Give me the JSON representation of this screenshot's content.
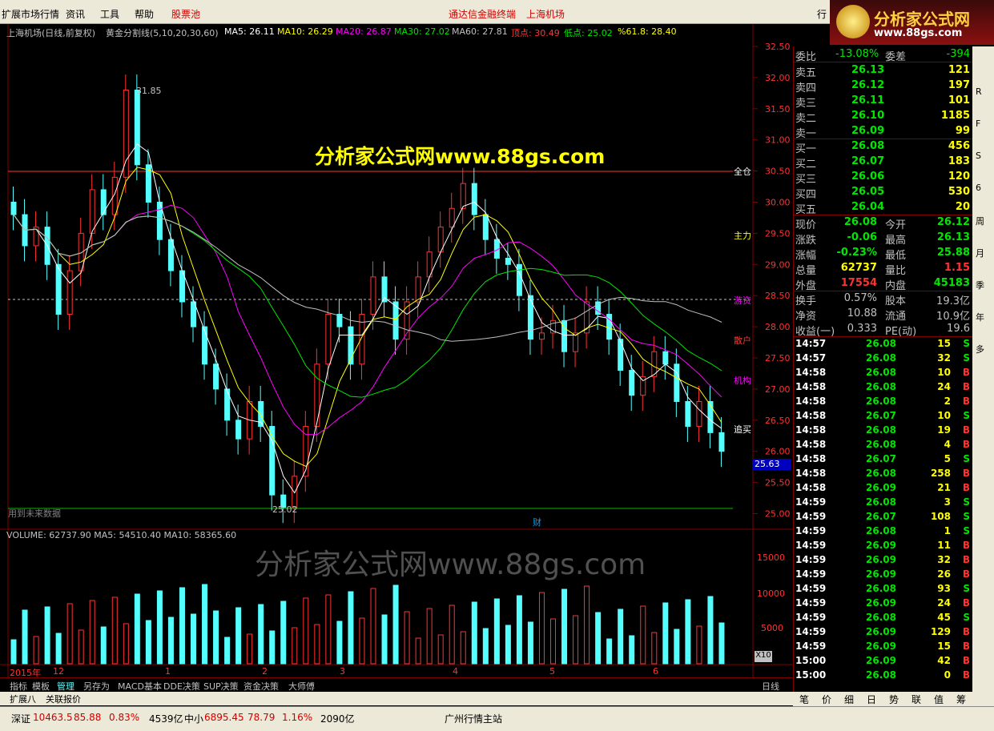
{
  "menu": {
    "items": [
      "扩展市场行情",
      "资讯",
      "工具",
      "帮助",
      "股票池"
    ],
    "center": [
      "通达信金融终端",
      "上海机场"
    ],
    "right": "行"
  },
  "logo": {
    "main": "分析家公式网",
    "url": "www.88gs.com"
  },
  "chart": {
    "title": "上海机场(日线,前复权)",
    "indicator": "黄金分割线(5,10,20,30,60)",
    "ma5": "MA5: 26.11",
    "ma10": "MA10: 26.29",
    "ma20": "MA20: 26.87",
    "ma30": "MA30: 27.02",
    "ma60": "MA60: 27.81",
    "top": "顶点: 30.49",
    "bottom": "低点: 25.02",
    "fib": "%61.8: 28.40",
    "high_label": "31.85",
    "low_label": "25.02",
    "future_note": "用到未来数据",
    "cai": "财",
    "watermark": "分析家公式网www.88gs.com",
    "watermark2": "分析家公式网www.88gs.com",
    "levels": [
      "全仓",
      "主力",
      "游资",
      "散户",
      "机构",
      "追买"
    ],
    "price_axis": [
      "32.50",
      "32.00",
      "31.50",
      "31.00",
      "30.50",
      "30.00",
      "29.50",
      "29.00",
      "28.50",
      "28.00",
      "27.50",
      "27.00",
      "26.50",
      "26.00",
      "25.50",
      "25.00"
    ],
    "current_price": "25.63",
    "volume_line": "VOLUME: 62737.90  MA5: 54510.40  MA10: 58365.60",
    "vol_axis": [
      "15000",
      "10000",
      "5000"
    ],
    "vol_unit": "X10",
    "date_labels": [
      "2015年",
      "12",
      "1",
      "2",
      "3",
      "4",
      "5",
      "6"
    ]
  },
  "bottom_tabs": [
    "指标",
    "模板",
    "管理",
    "另存为",
    "MACD基本",
    "DDE决策",
    "SUP决策",
    "资金决策",
    "大师傅"
  ],
  "period": "日线",
  "period_btns": [
    "+",
    "-",
    "0"
  ],
  "sub_tabs": [
    "扩展八",
    "关联报价"
  ],
  "status": {
    "sz_label": "深证",
    "sz_val": "10463.5",
    "sz_chg": "85.88",
    "sz_pct": "0.83%",
    "sz_amt": "4539亿",
    "zx_label": "中小",
    "zx_val": "6895.45",
    "zx_chg": "78.79",
    "zx_pct": "1.16%",
    "zx_amt": "2090亿",
    "station": "广州行情主站"
  },
  "quote": {
    "weibi_label": "委比",
    "weibi": "-13.08%",
    "weicha_label": "委差",
    "weicha": "-394",
    "sells": [
      {
        "label": "卖五",
        "price": "26.13",
        "vol": "121"
      },
      {
        "label": "卖四",
        "price": "26.12",
        "vol": "197"
      },
      {
        "label": "卖三",
        "price": "26.11",
        "vol": "101"
      },
      {
        "label": "卖二",
        "price": "26.10",
        "vol": "1185"
      },
      {
        "label": "卖一",
        "price": "26.09",
        "vol": "99"
      }
    ],
    "buys": [
      {
        "label": "买一",
        "price": "26.08",
        "vol": "456"
      },
      {
        "label": "买二",
        "price": "26.07",
        "vol": "183"
      },
      {
        "label": "买三",
        "price": "26.06",
        "vol": "120"
      },
      {
        "label": "买四",
        "price": "26.05",
        "vol": "530"
      },
      {
        "label": "买五",
        "price": "26.04",
        "vol": "20"
      }
    ],
    "stats": [
      {
        "l1": "现价",
        "v1": "26.08",
        "l2": "今开",
        "v2": "26.12"
      },
      {
        "l1": "涨跌",
        "v1": "-0.06",
        "l2": "最高",
        "v2": "26.13"
      },
      {
        "l1": "涨幅",
        "v1": "-0.23%",
        "l2": "最低",
        "v2": "25.88"
      },
      {
        "l1": "总量",
        "v1": "62737",
        "l2": "量比",
        "v2": "1.15"
      },
      {
        "l1": "外盘",
        "v1": "17554",
        "l2": "内盘",
        "v2": "45183"
      }
    ],
    "fund": [
      {
        "l1": "换手",
        "v1": "0.57%",
        "l2": "股本",
        "v2": "19.3亿"
      },
      {
        "l1": "净资",
        "v1": "10.88",
        "l2": "流通",
        "v2": "10.9亿"
      },
      {
        "l1": "收益(一)",
        "v1": "0.333",
        "l2": "PE(动)",
        "v2": "19.6"
      }
    ]
  },
  "ticks": [
    {
      "t": "14:57",
      "p": "26.08",
      "v": "15",
      "s": "S"
    },
    {
      "t": "14:57",
      "p": "26.08",
      "v": "32",
      "s": "S"
    },
    {
      "t": "14:58",
      "p": "26.08",
      "v": "10",
      "s": "B"
    },
    {
      "t": "14:58",
      "p": "26.08",
      "v": "24",
      "s": "B"
    },
    {
      "t": "14:58",
      "p": "26.08",
      "v": "2",
      "s": "B"
    },
    {
      "t": "14:58",
      "p": "26.07",
      "v": "10",
      "s": "S"
    },
    {
      "t": "14:58",
      "p": "26.08",
      "v": "19",
      "s": "B"
    },
    {
      "t": "14:58",
      "p": "26.08",
      "v": "4",
      "s": "B"
    },
    {
      "t": "14:58",
      "p": "26.07",
      "v": "5",
      "s": "S"
    },
    {
      "t": "14:58",
      "p": "26.08",
      "v": "258",
      "s": "B"
    },
    {
      "t": "14:58",
      "p": "26.09",
      "v": "21",
      "s": "B"
    },
    {
      "t": "14:59",
      "p": "26.08",
      "v": "3",
      "s": "S"
    },
    {
      "t": "14:59",
      "p": "26.07",
      "v": "108",
      "s": "S"
    },
    {
      "t": "14:59",
      "p": "26.08",
      "v": "1",
      "s": "S"
    },
    {
      "t": "14:59",
      "p": "26.09",
      "v": "11",
      "s": "B"
    },
    {
      "t": "14:59",
      "p": "26.09",
      "v": "32",
      "s": "B"
    },
    {
      "t": "14:59",
      "p": "26.09",
      "v": "26",
      "s": "B"
    },
    {
      "t": "14:59",
      "p": "26.08",
      "v": "93",
      "s": "S"
    },
    {
      "t": "14:59",
      "p": "26.09",
      "v": "24",
      "s": "B"
    },
    {
      "t": "14:59",
      "p": "26.08",
      "v": "45",
      "s": "S"
    },
    {
      "t": "14:59",
      "p": "26.09",
      "v": "129",
      "s": "B"
    },
    {
      "t": "14:59",
      "p": "26.09",
      "v": "15",
      "s": "B"
    },
    {
      "t": "15:00",
      "p": "26.09",
      "v": "42",
      "s": "B"
    },
    {
      "t": "15:00",
      "p": "26.08",
      "v": "0",
      "s": "B"
    }
  ],
  "rp_tabs": [
    "笔",
    "价",
    "细",
    "日",
    "势",
    "联",
    "值",
    "筹"
  ],
  "side_strip": [
    "R",
    "F",
    "S",
    "6",
    "周",
    "月",
    "季",
    "年",
    "多"
  ],
  "colors": {
    "red": "#ff3232",
    "green": "#00e600",
    "cyan": "#54ffff",
    "yellow": "#ffff00",
    "magenta": "#ff00ff",
    "white": "#ffffff"
  }
}
